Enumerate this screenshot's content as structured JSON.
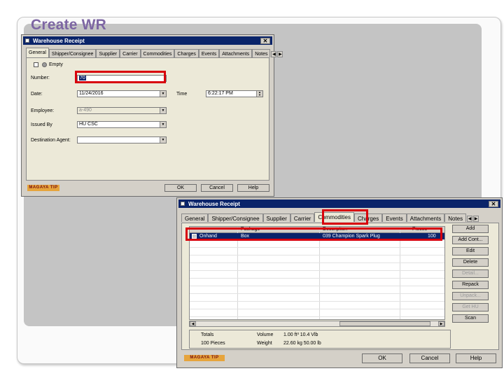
{
  "slide": {
    "title": "Create WR"
  },
  "win1": {
    "title": "Warehouse Receipt",
    "close": "✕",
    "tabs": [
      "General",
      "Shipper/Consignee",
      "Supplier",
      "Carrier",
      "Commodities",
      "Charges",
      "Events",
      "Attachments",
      "Notes"
    ],
    "empty_label": "Empty",
    "fields": {
      "number": {
        "label": "Number:",
        "value": "70"
      },
      "date": {
        "label": "Date:",
        "value": "11/24/2016"
      },
      "time": {
        "label": "Time",
        "value": "6:22:17 PM"
      },
      "employee": {
        "label": "Employee:",
        "value": "a-490"
      },
      "issued_by": {
        "label": "Issued By",
        "value": "HU CSC"
      },
      "destination_agent": {
        "label": "Destination Agent:",
        "value": ""
      }
    },
    "logo": "MAGAYA TIP",
    "buttons": {
      "ok": "OK",
      "cancel": "Cancel",
      "help": "Help"
    }
  },
  "win2": {
    "title": "Warehouse Receipt",
    "close": "✕",
    "tabs": [
      "General",
      "Shipper/Consignee",
      "Supplier",
      "Carrier",
      "Commodities",
      "Charges",
      "Events",
      "Attachments",
      "Notes"
    ],
    "grid": {
      "headers": [
        "",
        "Package",
        "Description",
        "Pieces"
      ],
      "rows": [
        {
          "status": "Onhand",
          "package": "Box",
          "description": "039 Champion Spark Plug",
          "pieces": "100"
        }
      ]
    },
    "side_buttons": [
      {
        "label": "Add",
        "enabled": true
      },
      {
        "label": "Add Cont...",
        "enabled": true
      },
      {
        "label": "Edit",
        "enabled": true
      },
      {
        "label": "Delete",
        "enabled": true
      },
      {
        "label": "Detail...",
        "enabled": false
      },
      {
        "label": "Repack",
        "enabled": true
      },
      {
        "label": "Unpack...",
        "enabled": false
      },
      {
        "label": "Get HU",
        "enabled": false
      },
      {
        "label": "Scan",
        "enabled": true
      }
    ],
    "totals": {
      "label": "Totals",
      "pieces": "100 Pieces",
      "volume_label": "Volume",
      "volume_value": "1.00 ft³  10.4  Vlb",
      "weight_label": "Weight",
      "weight_value": "22.60 kg  50.00 lb"
    },
    "logo": "MAGAYA TIP",
    "buttons": {
      "ok": "OK",
      "cancel": "Cancel",
      "help": "Help"
    }
  },
  "highlight_color": "#d8000c",
  "title_color": "#7d66a3",
  "titlebar_color": "#0a246a"
}
